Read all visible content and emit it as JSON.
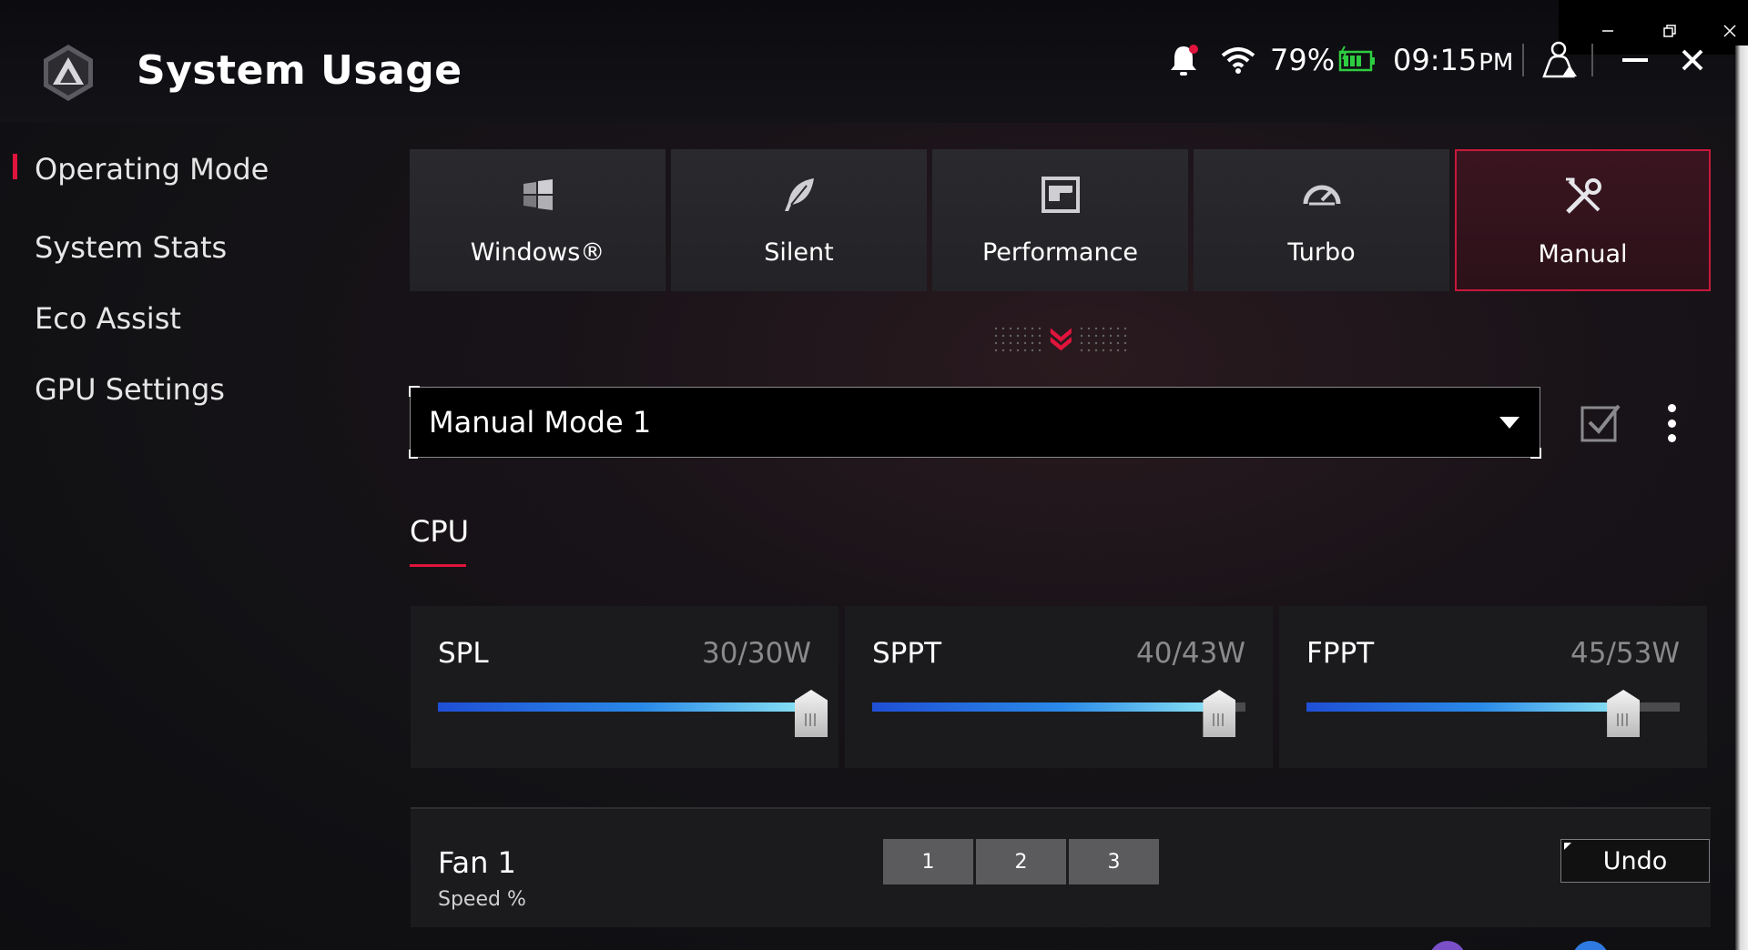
{
  "app": {
    "title": "System Usage"
  },
  "status": {
    "battery_percent": "79%",
    "time": "09:15",
    "ampm": "PM"
  },
  "sidebar": {
    "items": [
      {
        "label": "Operating Mode",
        "active": true
      },
      {
        "label": "System Stats",
        "active": false
      },
      {
        "label": "Eco Assist",
        "active": false
      },
      {
        "label": "GPU Settings",
        "active": false
      }
    ]
  },
  "modes": [
    {
      "label": "Windows®",
      "icon": "windows-icon",
      "active": false
    },
    {
      "label": "Silent",
      "icon": "leaf-icon",
      "active": false
    },
    {
      "label": "Performance",
      "icon": "performance-icon",
      "active": false
    },
    {
      "label": "Turbo",
      "icon": "speedometer-icon",
      "active": false
    },
    {
      "label": "Manual",
      "icon": "tools-icon",
      "active": true
    }
  ],
  "profile": {
    "selected": "Manual Mode 1"
  },
  "section": {
    "cpu_label": "CPU"
  },
  "power_limits": [
    {
      "name": "SPL",
      "value_text": "30/30W",
      "value": 30,
      "max": 30
    },
    {
      "name": "SPPT",
      "value_text": "40/43W",
      "value": 40,
      "max": 43
    },
    {
      "name": "FPPT",
      "value_text": "45/53W",
      "value": 45,
      "max": 53
    }
  ],
  "fan": {
    "title": "Fan 1",
    "subtitle": "Speed %",
    "steps": [
      "1",
      "2",
      "3"
    ],
    "undo_label": "Undo"
  },
  "colors": {
    "accent": "#e0143c",
    "slider_start": "#1f4fd6",
    "slider_end": "#8de6f4"
  }
}
